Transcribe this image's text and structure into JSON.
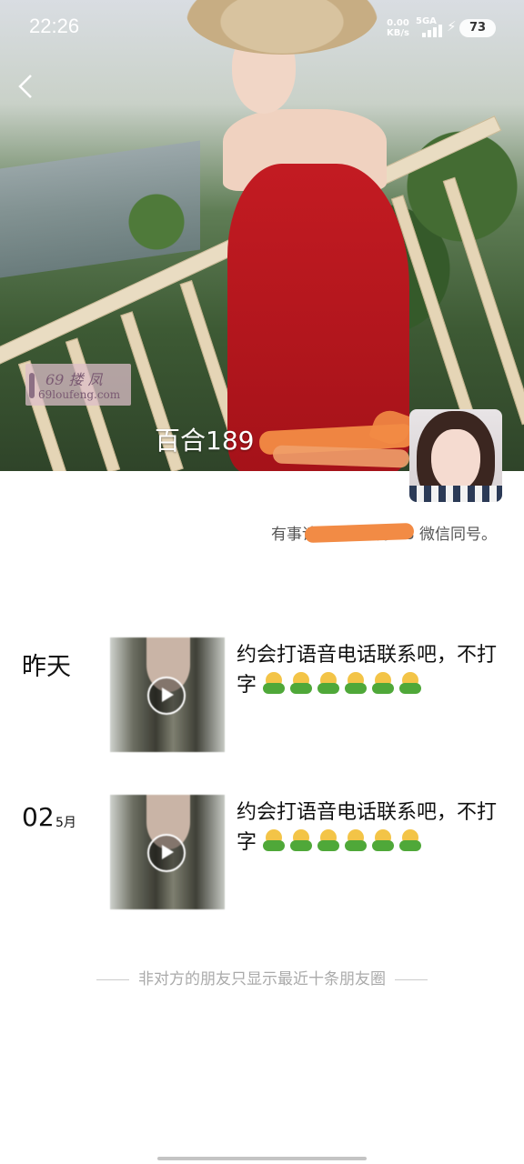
{
  "status_bar": {
    "time": "22:26",
    "net_speed": "0.00",
    "net_unit": "KB/s",
    "network": "5GA",
    "battery": "73"
  },
  "header": {
    "back_icon": "chevron-left-icon",
    "watermark_line1": "69 搂 凤",
    "watermark_line2": "69loufeng.com",
    "name": "百合189"
  },
  "profile": {
    "signature": "有事请打电话联系18          微信同号。"
  },
  "posts": [
    {
      "date": "昨天",
      "text": "约会打语音电话联系吧，不打字",
      "emoji_count": 6
    },
    {
      "day": "02",
      "month": "5月",
      "text": "约会打语音电话联系吧，不打字",
      "emoji_count": 6
    }
  ],
  "footer": {
    "note": "非对方的朋友只显示最近十条朋友圈"
  }
}
